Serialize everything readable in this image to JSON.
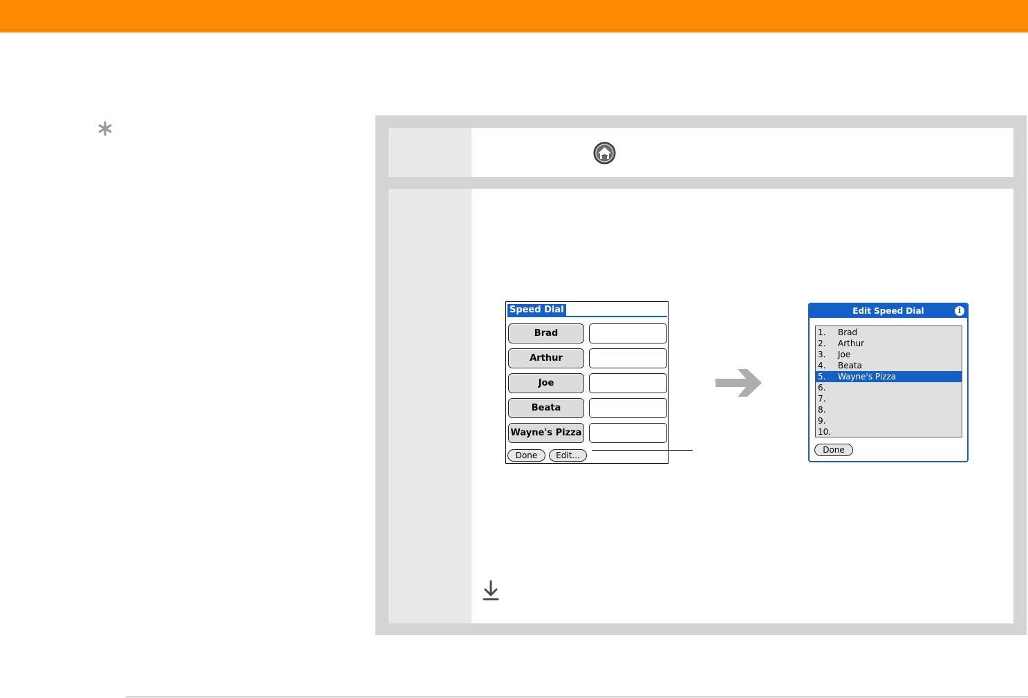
{
  "speed_dial": {
    "title": "Speed Dial",
    "buttons": [
      "Brad",
      "Arthur",
      "Joe",
      "Beata",
      "Wayne's Pizza"
    ],
    "done_label": "Done",
    "edit_label": "Edit..."
  },
  "edit_speed_dial": {
    "title": "Edit Speed Dial",
    "info_glyph": "i",
    "entries": [
      {
        "num": "1.",
        "name": "Brad"
      },
      {
        "num": "2.",
        "name": "Arthur"
      },
      {
        "num": "3.",
        "name": "Joe"
      },
      {
        "num": "4.",
        "name": "Beata"
      },
      {
        "num": "5.",
        "name": "Wayne's Pizza"
      },
      {
        "num": "6.",
        "name": ""
      },
      {
        "num": "7.",
        "name": ""
      },
      {
        "num": "8.",
        "name": ""
      },
      {
        "num": "9.",
        "name": ""
      },
      {
        "num": "10.",
        "name": ""
      }
    ],
    "selected_index": 4,
    "done_label": "Done"
  },
  "colors": {
    "header_orange": "#ff8a00",
    "palm_blue": "#1560c7",
    "panel_gray": "#d4d4d4"
  },
  "icons": [
    "tip-star-icon",
    "home-icon",
    "right-arrow-icon",
    "continue-down-arrow-icon",
    "info-icon"
  ]
}
